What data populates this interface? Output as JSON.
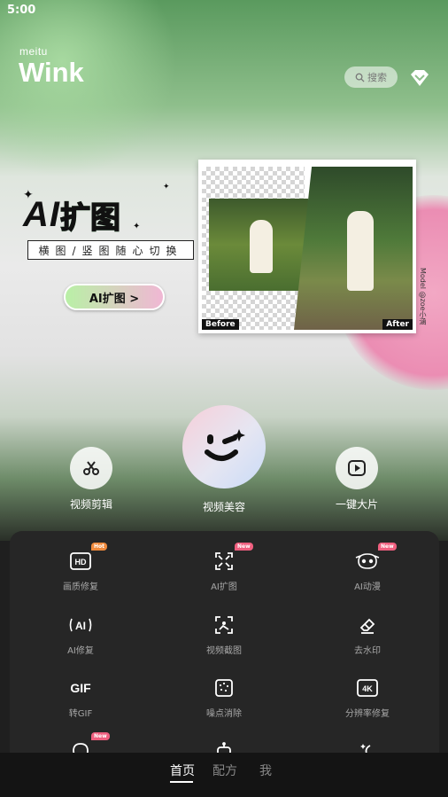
{
  "status_bar": {
    "time": "5:00"
  },
  "brand": {
    "small": "meitu",
    "big": "Wink"
  },
  "search": {
    "placeholder": "搜索",
    "icon": "search-icon"
  },
  "vip_icon": "diamond-icon",
  "banner": {
    "title_latin": "AI",
    "title_cn": "扩图",
    "subtitle": "横图/竖图随心切换",
    "cta_label": "AI扩图 >",
    "before_label": "Before",
    "after_label": "After",
    "model_credit": "Model @zoe小涵"
  },
  "quick_actions": [
    {
      "label": "视频剪辑",
      "icon": "scissors-icon"
    },
    {
      "label": "视频美容",
      "icon": "wink-face-icon"
    },
    {
      "label": "一键大片",
      "icon": "play-icon"
    }
  ],
  "tools": [
    {
      "label": "画质修复",
      "icon": "hd-icon",
      "badge": "Hot"
    },
    {
      "label": "AI扩图",
      "icon": "expand-icon",
      "badge": "New"
    },
    {
      "label": "AI动漫",
      "icon": "anime-face-icon",
      "badge": "New"
    },
    {
      "label": "AI修复",
      "icon": "ai-repair-icon",
      "badge": ""
    },
    {
      "label": "视频截图",
      "icon": "screenshot-icon",
      "badge": ""
    },
    {
      "label": "去水印",
      "icon": "eraser-icon",
      "badge": ""
    },
    {
      "label": "转GIF",
      "icon": "gif-icon",
      "badge": ""
    },
    {
      "label": "噪点消除",
      "icon": "denoise-icon",
      "badge": ""
    },
    {
      "label": "分辨率修复",
      "icon": "4k-icon",
      "badge": ""
    },
    {
      "label": "",
      "icon": "chat-icon",
      "badge": "New"
    },
    {
      "label": "",
      "icon": "robot-icon",
      "badge": ""
    },
    {
      "label": "",
      "icon": "sparkle-moon-icon",
      "badge": ""
    }
  ],
  "icon_text": {
    "hd": "HD",
    "gif": "GIF",
    "k4": "4K",
    "ai": "AI"
  },
  "tabs": [
    {
      "label": "首页",
      "active": true
    },
    {
      "label": "配方",
      "active": false
    },
    {
      "label": "我",
      "active": false
    }
  ]
}
